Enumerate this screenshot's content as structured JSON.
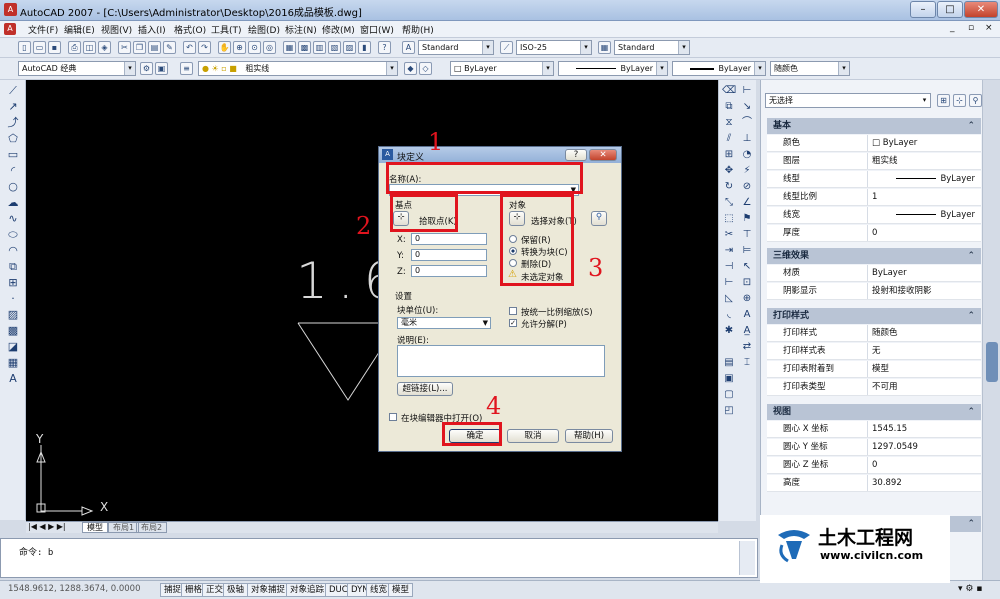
{
  "window": {
    "title": "AutoCAD 2007 - [C:\\Users\\Administrator\\Desktop\\2016成品模板.dwg]",
    "app_icon": "A"
  },
  "menu": [
    "文件(F)",
    "编辑(E)",
    "视图(V)",
    "插入(I)",
    "格式(O)",
    "工具(T)",
    "绘图(D)",
    "标注(N)",
    "修改(M)",
    "窗口(W)",
    "帮助(H)"
  ],
  "toolbar": {
    "text_style": "Standard",
    "dim_style": "ISO-25",
    "table_style": "Standard",
    "workspace": "AutoCAD 经典",
    "layer": "粗实线",
    "color": "ByLayer",
    "linetype": "ByLayer",
    "lineweight": "ByLayer",
    "plotstyle": "随颜色"
  },
  "canvas": {
    "drawn_text": "1.6",
    "ucs_x": "X",
    "ucs_y": "Y"
  },
  "tabs": [
    "模型",
    "布局1",
    "布局2"
  ],
  "command": {
    "prompt": "命令: b"
  },
  "status": {
    "coords": "1548.9612, 1288.3674, 0.0000",
    "buttons": [
      "捕捉",
      "栅格",
      "正交",
      "极轴",
      "对象捕捉",
      "对象追踪",
      "DUCS",
      "DYN",
      "线宽",
      "模型"
    ]
  },
  "properties": {
    "selection": "无选择",
    "sections": [
      {
        "title": "基本",
        "rows": [
          {
            "label": "颜色",
            "value": "ByLayer"
          },
          {
            "label": "图层",
            "value": "粗实线"
          },
          {
            "label": "线型",
            "value": "ByLayer"
          },
          {
            "label": "线型比例",
            "value": "1"
          },
          {
            "label": "线宽",
            "value": "ByLayer"
          },
          {
            "label": "厚度",
            "value": "0"
          }
        ]
      },
      {
        "title": "三维效果",
        "rows": [
          {
            "label": "材质",
            "value": "ByLayer"
          },
          {
            "label": "阴影显示",
            "value": "投射和接收阴影"
          }
        ]
      },
      {
        "title": "打印样式",
        "rows": [
          {
            "label": "打印样式",
            "value": "随颜色"
          },
          {
            "label": "打印样式表",
            "value": "无"
          },
          {
            "label": "打印表附着到",
            "value": "模型"
          },
          {
            "label": "打印表类型",
            "value": "不可用"
          }
        ]
      },
      {
        "title": "视图",
        "rows": [
          {
            "label": "圆心 X 坐标",
            "value": "1545.15"
          },
          {
            "label": "圆心 Y 坐标",
            "value": "1297.0549"
          },
          {
            "label": "圆心 Z 坐标",
            "value": "0"
          },
          {
            "label": "高度",
            "value": "30.892"
          }
        ]
      }
    ]
  },
  "dialog": {
    "title": "块定义",
    "name_label": "名称(A):",
    "name_value": "",
    "base_label": "基点",
    "pick_point": "拾取点(K)",
    "x_label": "X:",
    "y_label": "Y:",
    "z_label": "Z:",
    "x_value": "0",
    "y_value": "0",
    "z_value": "0",
    "objects_label": "对象",
    "select_objects": "选择对象(T)",
    "retain": "保留(R)",
    "convert": "转换为块(C)",
    "delete": "删除(D)",
    "warning": "未选定对象",
    "settings_label": "设置",
    "units_label": "块单位(U):",
    "units_value": "毫米",
    "uniform_scale": "按统一比例缩放(S)",
    "allow_explode": "允许分解(P)",
    "description_label": "说明(E):",
    "hyperlink": "超链接(L)...",
    "open_in_editor": "在块编辑器中打开(O)",
    "ok": "确定",
    "cancel": "取消",
    "help": "帮助(H)"
  },
  "annotations": [
    "1",
    "2",
    "3",
    "4"
  ],
  "watermark": {
    "name": "土木工程网",
    "url": "www.civilcn.com"
  }
}
